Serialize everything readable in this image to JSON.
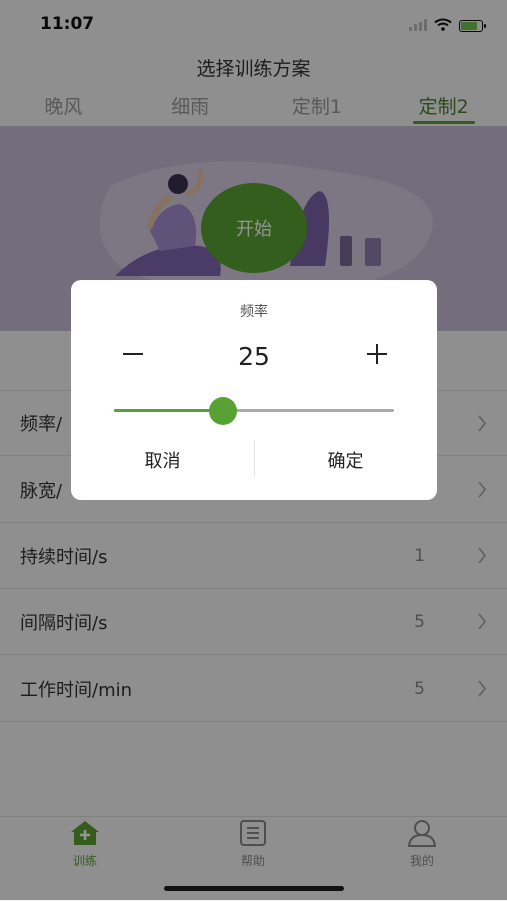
{
  "status_bar": {
    "time": "11:07"
  },
  "header": {
    "title": "选择训练方案",
    "tabs": [
      {
        "label": "晚风",
        "active": false
      },
      {
        "label": "细雨",
        "active": false
      },
      {
        "label": "定制1",
        "active": false
      },
      {
        "label": "定制2",
        "active": true
      }
    ]
  },
  "hero": {
    "start_label": "开始"
  },
  "settings": [
    {
      "label": "频率/",
      "value": ""
    },
    {
      "label": "脉宽/",
      "value": ""
    },
    {
      "label": "持续时间/s",
      "value": "1"
    },
    {
      "label": "间隔时间/s",
      "value": "5"
    },
    {
      "label": "工作时间/min",
      "value": "5"
    }
  ],
  "tabbar": {
    "items": [
      {
        "label": "训练",
        "icon": "home-plus-icon",
        "active": true
      },
      {
        "label": "帮助",
        "icon": "document-icon",
        "active": false
      },
      {
        "label": "我的",
        "icon": "user-icon",
        "active": false
      }
    ]
  },
  "dialog": {
    "title": "频率",
    "value": "25",
    "slider_fraction": 0.39,
    "cancel_label": "取消",
    "confirm_label": "确定"
  },
  "colors": {
    "accent": "#58a233",
    "hero_bg": "#c8bcd6",
    "text": "#333333"
  }
}
